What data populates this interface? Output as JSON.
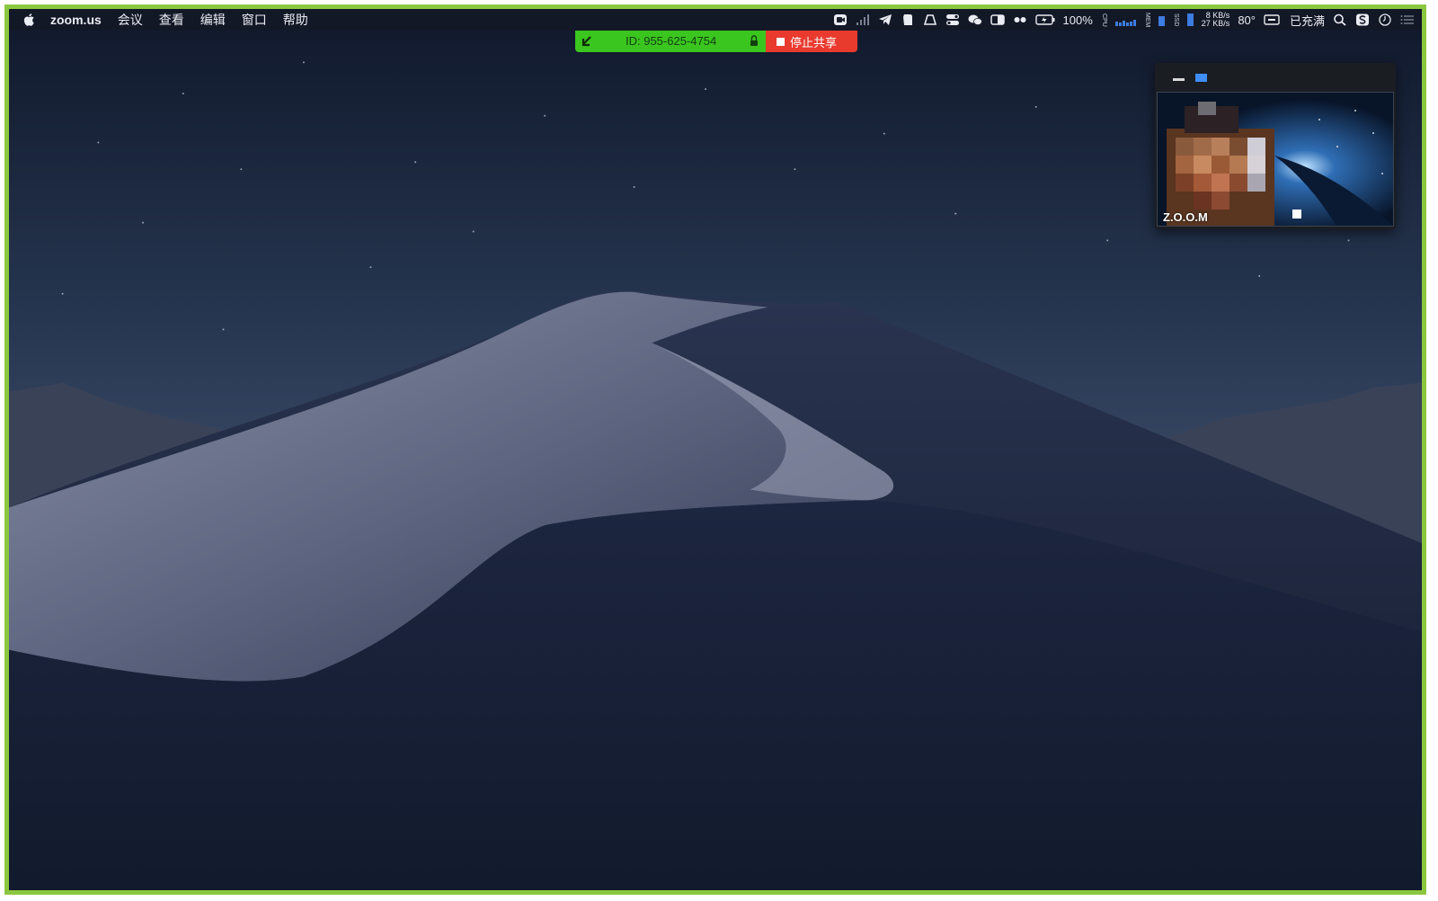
{
  "menubar": {
    "app_name": "zoom.us",
    "menus": [
      "会议",
      "查看",
      "编辑",
      "窗口",
      "帮助"
    ],
    "status": {
      "battery": "100%",
      "net_up": "8 KB/s",
      "net_down": "27 KB/s",
      "temperature": "80°",
      "power_status": "已充满"
    }
  },
  "share_bar": {
    "meeting_id": "ID: 955-625-4754",
    "stop_label": "停止共享",
    "colors": {
      "id_bg": "#3bc51f",
      "stop_bg": "#e93a2e"
    }
  },
  "video_window": {
    "participant_name": "Z.O.O.M"
  },
  "icons": [
    "apple-icon",
    "zoom-icon",
    "signal-icon",
    "telegram-icon",
    "evernote-icon",
    "drive-icon",
    "toggle-icon",
    "wechat-icon",
    "window-icon",
    "dots-icon",
    "battery-icon",
    "cpu-icon",
    "search-icon",
    "siri-icon",
    "clock-icon",
    "notification-center-icon",
    "arrow-icon",
    "lock-icon"
  ]
}
